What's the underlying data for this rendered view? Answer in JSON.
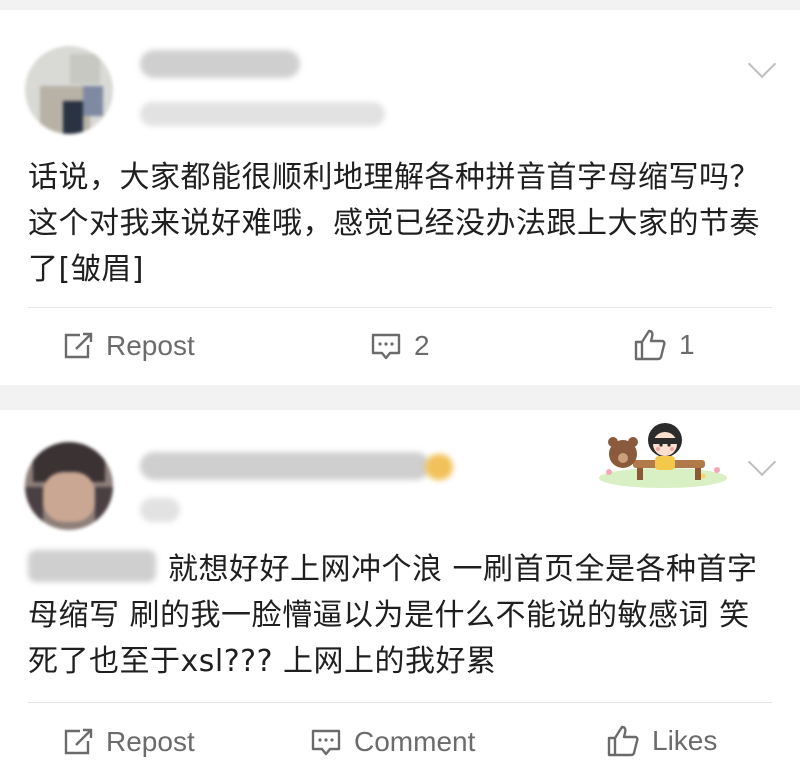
{
  "posts": [
    {
      "text": "话说，大家都能很顺利地理解各种拼音首字母缩写吗？这个对我来说好难哦，感觉已经没办法跟上大家的节奏了[皱眉]",
      "actions": {
        "repost": "Repost",
        "comments": "2",
        "likes": "1"
      }
    },
    {
      "text": "就想好好上网冲个浪 一刷首页全是各种首字母缩写 刷的我一脸懵逼以为是什么不能说的敏感词  笑死了也至于xsl???  上网上的我好累",
      "actions": {
        "repost": "Repost",
        "comments": "Comment",
        "likes": "Likes"
      }
    }
  ],
  "icons": {
    "repost": "repost-icon",
    "comment": "comment-icon",
    "like": "thumbs-up-icon",
    "chevron": "chevron-down-icon"
  },
  "colors": {
    "background": "#f2f2f2",
    "card": "#ffffff",
    "text": "#1f1f1f",
    "muted": "#6b6b6b"
  }
}
